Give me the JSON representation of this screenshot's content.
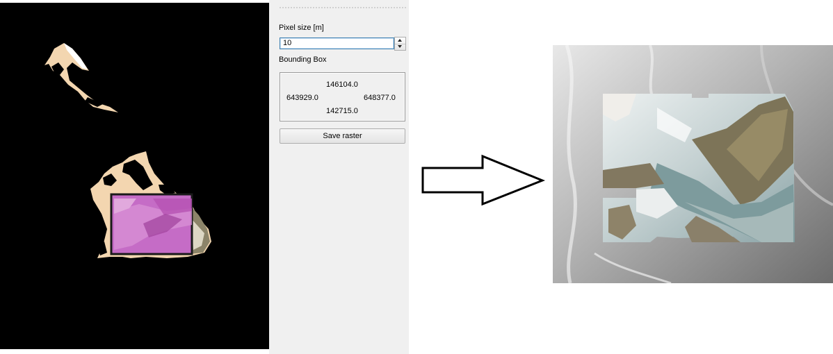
{
  "panel": {
    "pixel_size_label": "Pixel size [m]",
    "pixel_size_value": "10",
    "bounding_box_label": "Bounding Box",
    "bbox": {
      "north": "146104.0",
      "west": "643929.0",
      "east": "648377.0",
      "south": "142715.0"
    },
    "save_raster_label": "Save raster"
  },
  "icons": {
    "spin_up": "chevron-up-icon",
    "spin_down": "chevron-down-icon",
    "arrow": "right-arrow-icon"
  },
  "colors": {
    "canvas_background": "#000000",
    "panel_background": "#f0f0f0",
    "selection_overlay": "#c060c0",
    "input_focus_border": "#3c7fb1"
  }
}
